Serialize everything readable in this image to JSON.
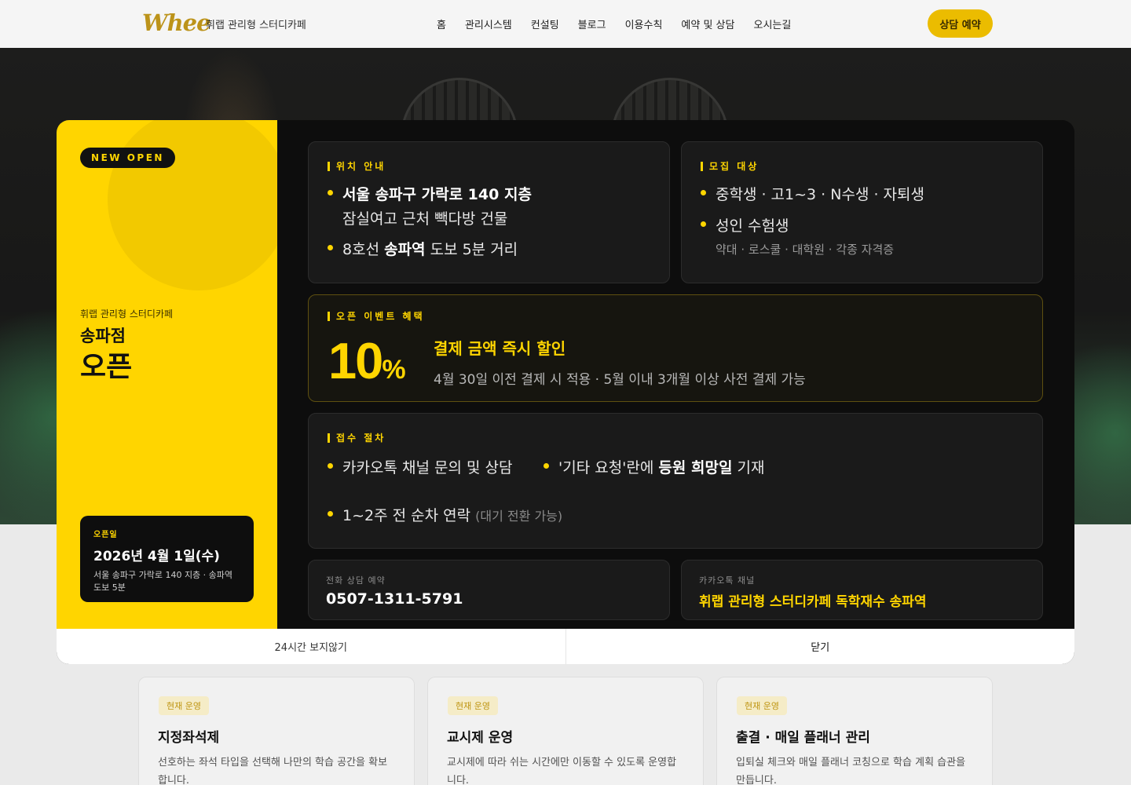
{
  "header": {
    "logo": "Whee",
    "brand_subtitle": "휘랩 관리형 스터디카페",
    "nav": [
      "홈",
      "관리시스템",
      "컨설팅",
      "블로그",
      "이용수칙",
      "예약 및 상담",
      "오시는길"
    ],
    "cta": "상담 예약"
  },
  "modal": {
    "left": {
      "badge": "NEW OPEN",
      "subtitle": "휘랩 관리형 스터디카페",
      "branch": "송파점",
      "headline": "오픈",
      "open_card": {
        "label": "오픈일",
        "date": "2026년 4월 1일(수)",
        "address": "서울 송파구 가락로 140 지층 · 송파역 도보 5분"
      }
    },
    "location": {
      "title": "위치 안내",
      "line1_bold": "서울 송파구 가락로 140 지층",
      "line1_sub": "잠실여고 근처 빽다방 건물",
      "line2_pre": "8호선 ",
      "line2_bold": "송파역",
      "line2_post": " 도보 5분 거리"
    },
    "target": {
      "title": "모집 대상",
      "item1": "중학생 · 고1~3 · N수생 · 자퇴생",
      "item2": "성인 수험생",
      "item2_sub": "약대 · 로스쿨 · 대학원 · 각종 자격증"
    },
    "promo": {
      "title": "오픈 이벤트 혜택",
      "number": "10",
      "percent": "%",
      "headline": "결제 금액 즉시 할인",
      "desc": "4월 30일 이전 결제 시 적용 · 5월 이내 3개월 이상 사전 결제 가능"
    },
    "procedure": {
      "title": "접수 절차",
      "step1": "카카오톡 채널 문의 및 상담",
      "step2_pre": "'기타 요청'란에 ",
      "step2_bold": "등원 희망일",
      "step2_post": " 기재",
      "step3": "1~2주 전 순차 연락",
      "step3_note": "(대기 전환 가능)"
    },
    "contact_phone": {
      "label": "전화 상담 예약",
      "value": "0507-1311-5791"
    },
    "contact_kakao": {
      "label": "카카오톡 채널",
      "value": "휘랩 관리형 스터디카페 독학재수 송파역"
    },
    "footer": {
      "hide_24h": "24시간 보지않기",
      "close": "닫기"
    }
  },
  "cards": [
    {
      "tag": "현재 운영",
      "title": "지정좌석제",
      "desc": "선호하는 좌석 타입을 선택해 나만의 학습 공간을 확보합니다."
    },
    {
      "tag": "현재 운영",
      "title": "교시제 운영",
      "desc": "교시제에 따라 쉬는 시간에만 이동할 수 있도록 운영합니다."
    },
    {
      "tag": "현재 운영",
      "title": "출결 · 매일 플래너 관리",
      "desc": "입퇴실 체크와 매일 플래너 코칭으로 학습 계획 습관을 만듭니다."
    }
  ],
  "colors": {
    "accent": "#ffd500",
    "modal_dark": "#0d0d0d",
    "cta": "#f5c400"
  }
}
